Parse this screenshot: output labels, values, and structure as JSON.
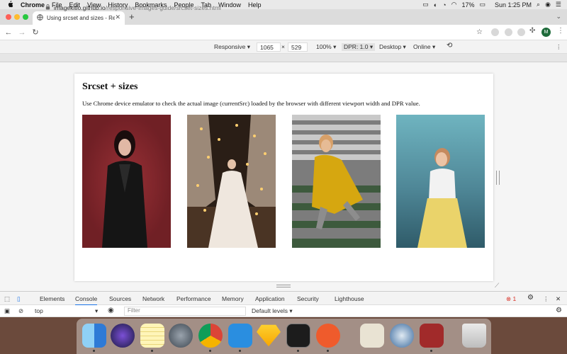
{
  "menubar": {
    "apple": "",
    "items": [
      "Chrome",
      "File",
      "Edit",
      "View",
      "History",
      "Bookmarks",
      "People",
      "Tab",
      "Window",
      "Help"
    ],
    "battery": "17%",
    "clock": "Sun 1:25 PM"
  },
  "browser": {
    "tab_title": "Using srcset and sizes - Respo",
    "url_host": "imagekitio.github.io",
    "url_path": "/responsive-images-guide/srcset-sizes.html",
    "profile_initial": "M"
  },
  "devbar": {
    "mode": "Responsive",
    "width": "1065",
    "height": "529",
    "zoom": "100%",
    "dpr": "DPR: 1.0",
    "device_type": "Desktop",
    "network": "Online"
  },
  "page": {
    "title": "Srcset + sizes",
    "description": "Use Chrome device emulator to check the actual image (currentSrc) loaded by the browser with different viewport width and DPR value."
  },
  "devtools": {
    "tabs": [
      "Elements",
      "Console",
      "Sources",
      "Network",
      "Performance",
      "Memory",
      "Application",
      "Security",
      "Lighthouse"
    ],
    "active_tab": "Console",
    "error_count": "1",
    "context": "top",
    "filter_placeholder": "Filter",
    "levels": "Default levels"
  },
  "colors": {
    "accent": "#1a73e8",
    "error": "#d93025"
  }
}
